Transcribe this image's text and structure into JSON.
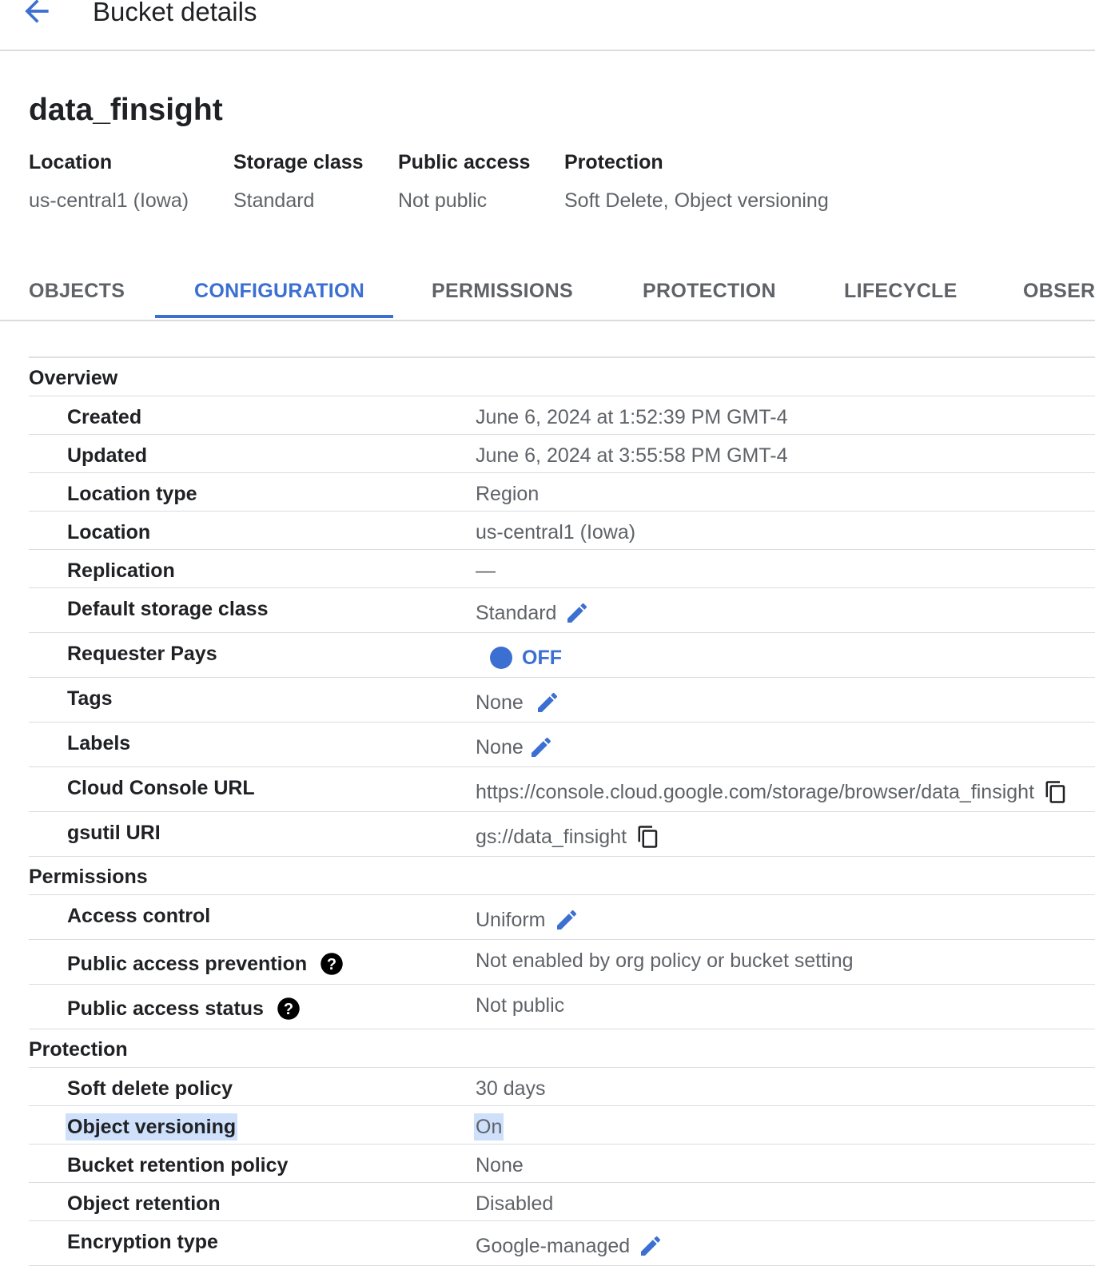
{
  "header": {
    "title": "Bucket details",
    "back_icon": "arrow-back-icon"
  },
  "bucket": {
    "name": "data_finsight"
  },
  "summary": [
    {
      "label": "Location",
      "value": "us-central1 (Iowa)"
    },
    {
      "label": "Storage class",
      "value": "Standard"
    },
    {
      "label": "Public access",
      "value": "Not public"
    },
    {
      "label": "Protection",
      "value": "Soft Delete, Object versioning"
    }
  ],
  "tabs": [
    "OBJECTS",
    "CONFIGURATION",
    "PERMISSIONS",
    "PROTECTION",
    "LIFECYCLE",
    "OBSERV"
  ],
  "active_tab": "CONFIGURATION",
  "colors": {
    "accent": "#3c6fd2",
    "highlight": "#cfe0fb"
  },
  "overview": {
    "title": "Overview",
    "created": {
      "label": "Created",
      "value": "June 6, 2024 at 1:52:39 PM GMT-4"
    },
    "updated": {
      "label": "Updated",
      "value": "June 6, 2024 at 3:55:58 PM GMT-4"
    },
    "location_type": {
      "label": "Location type",
      "value": "Region"
    },
    "location": {
      "label": "Location",
      "value": "us-central1 (Iowa)"
    },
    "replication": {
      "label": "Replication",
      "value": "—"
    },
    "default_storage_class": {
      "label": "Default storage class",
      "value": "Standard"
    },
    "requester_pays": {
      "label": "Requester Pays",
      "value": "OFF"
    },
    "tags": {
      "label": "Tags",
      "value": "None"
    },
    "labels": {
      "label": "Labels",
      "value": "None"
    },
    "console_url": {
      "label": "Cloud Console URL",
      "value": "https://console.cloud.google.com/storage/browser/data_finsight"
    },
    "gsutil_uri": {
      "label": "gsutil URI",
      "value": "gs://data_finsight"
    }
  },
  "permissions": {
    "title": "Permissions",
    "access_control": {
      "label": "Access control",
      "value": "Uniform"
    },
    "public_access_prevention": {
      "label": "Public access prevention",
      "value": "Not enabled by org policy or bucket setting"
    },
    "public_access_status": {
      "label": "Public access status",
      "value": "Not public"
    }
  },
  "protection": {
    "title": "Protection",
    "soft_delete": {
      "label": "Soft delete policy",
      "value": "30 days"
    },
    "object_versioning": {
      "label": "Object versioning",
      "value": "On"
    },
    "bucket_retention": {
      "label": "Bucket retention policy",
      "value": "None"
    },
    "object_retention": {
      "label": "Object retention",
      "value": "Disabled"
    },
    "encryption_type": {
      "label": "Encryption type",
      "value": "Google-managed"
    }
  }
}
